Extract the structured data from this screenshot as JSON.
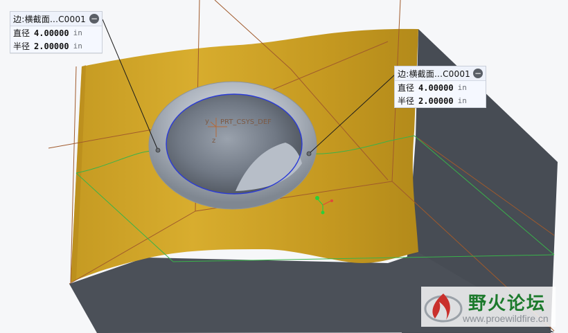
{
  "viewport": {
    "csys_label": "PRT_CSYS_DEF",
    "axis_y_label": "y",
    "axis_z_label": "z",
    "colors": {
      "face_yellow": "#c99e22",
      "face_gray": "#4a4f57",
      "datum_brown": "#a05a2c",
      "edge_green": "#39b34a",
      "selected_blue": "#2b3bd6"
    }
  },
  "notes": [
    {
      "title": "边:横截面...C0001",
      "minimize_symbol": "−",
      "rows": [
        {
          "label": "直径",
          "value": "4.00000",
          "unit": "in"
        },
        {
          "label": "半径",
          "value": "2.00000",
          "unit": "in"
        }
      ]
    },
    {
      "title": "边:横截面...C0001",
      "minimize_symbol": "−",
      "rows": [
        {
          "label": "直径",
          "value": "4.00000",
          "unit": "in"
        },
        {
          "label": "半径",
          "value": "2.00000",
          "unit": "in"
        }
      ]
    }
  ],
  "watermark": {
    "title": "野火论坛",
    "url": "www.proewildfire.cn"
  }
}
